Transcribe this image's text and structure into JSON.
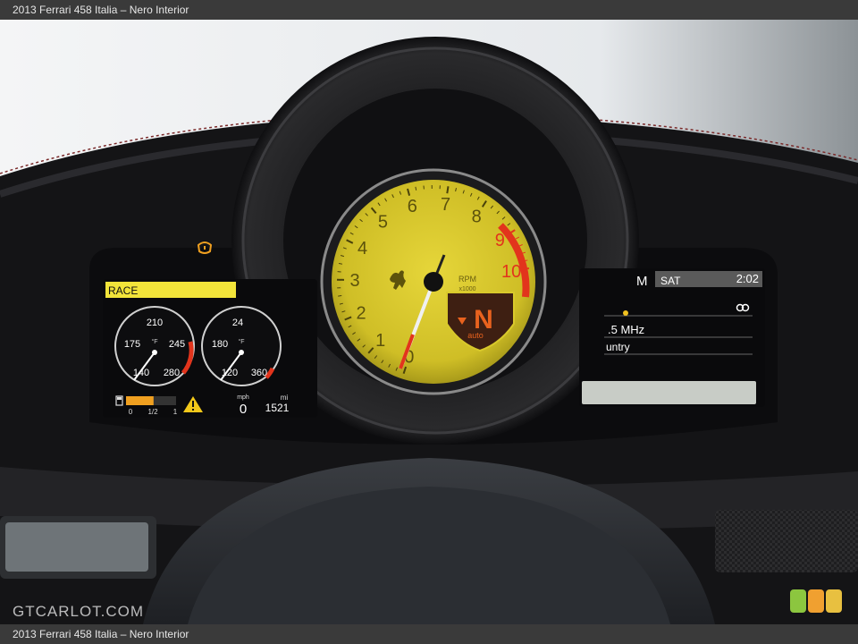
{
  "caption": "2013 Ferrari 458 Italia – Nero Interior",
  "watermark": "GTCARLOT.COM",
  "tachometer": {
    "numbers": [
      "0",
      "1",
      "2",
      "3",
      "4",
      "5",
      "6",
      "7",
      "8",
      "9",
      "10"
    ],
    "unit_line1": "RPM",
    "unit_line2": "x1000",
    "gear": "N",
    "mode": "auto"
  },
  "left_display": {
    "mode": "RACE",
    "gauge1": {
      "unit": "°F",
      "labels": [
        "210",
        "175",
        "245",
        "140",
        "280"
      ]
    },
    "gauge2": {
      "unit": "°F",
      "labels": [
        "24",
        "180",
        "120",
        "360"
      ]
    },
    "fuel": {
      "labels": [
        "0",
        "1/2",
        "1"
      ],
      "level": 0.55
    },
    "speed_unit": "mph",
    "speed": "0",
    "odometer_unit": "mi",
    "odometer": "1521"
  },
  "right_display": {
    "band": "M",
    "source": "SAT",
    "time": "2:02",
    "frequency": ".5 MHz",
    "genre": "untry"
  },
  "colors": {
    "lcd_yellow": "#f2e43a",
    "tach_face": "#d9c92b",
    "redline": "#e2341c"
  }
}
